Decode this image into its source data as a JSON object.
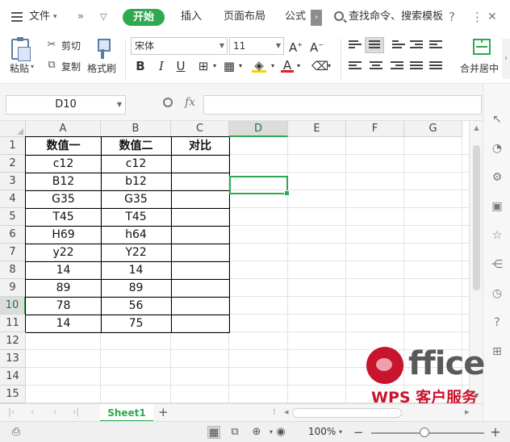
{
  "menu": {
    "file_label": "文件",
    "more_label": "»",
    "dropdown_label": "▽",
    "tabs": [
      "开始",
      "插入",
      "页面布局",
      "公式"
    ],
    "scroll_label": "›",
    "search_label": "查找命令、搜索模板",
    "help_label": "?",
    "more_options_label": "⋮",
    "close_label": "✕"
  },
  "ribbon": {
    "paste_label": "粘贴",
    "cut_label": "剪切",
    "copy_label": "复制",
    "format_painter_label": "格式刷",
    "font_name": "宋体",
    "font_size": "11",
    "bold_label": "B",
    "italic_label": "I",
    "underline_label": "U",
    "merge_center_label": "合并居中"
  },
  "formula_bar": {
    "cell_ref": "D10",
    "fx_label": "fx",
    "formula_value": ""
  },
  "grid": {
    "columns": [
      "A",
      "B",
      "C",
      "D",
      "E",
      "F",
      "G"
    ],
    "selected_column": "D",
    "rows": [
      "1",
      "2",
      "3",
      "4",
      "5",
      "6",
      "7",
      "8",
      "9",
      "10",
      "11",
      "12",
      "13",
      "14",
      "15"
    ],
    "selected_row": "10",
    "table": {
      "headers": [
        "数值一",
        "数值二",
        "对比"
      ],
      "rows": [
        [
          "c12",
          "c12",
          ""
        ],
        [
          "B12",
          "b12",
          ""
        ],
        [
          "G35",
          "G35",
          ""
        ],
        [
          "T45",
          "T45",
          ""
        ],
        [
          "H69",
          "h64",
          ""
        ],
        [
          "y22",
          "Y22",
          ""
        ],
        [
          "14",
          "14",
          ""
        ],
        [
          "89",
          "89",
          ""
        ],
        [
          "78",
          "56",
          ""
        ],
        [
          "14",
          "75",
          ""
        ]
      ]
    }
  },
  "sheets": {
    "tabs": [
      "Sheet1"
    ],
    "add_label": "+"
  },
  "status": {
    "zoom": "100%",
    "zoom_minus": "−",
    "zoom_plus": "+"
  },
  "watermark": {
    "word": "ffice",
    "subtitle": "WPS 客户服务"
  },
  "colors": {
    "accent": "#2fa84f",
    "watermark_red": "#c8142c"
  }
}
